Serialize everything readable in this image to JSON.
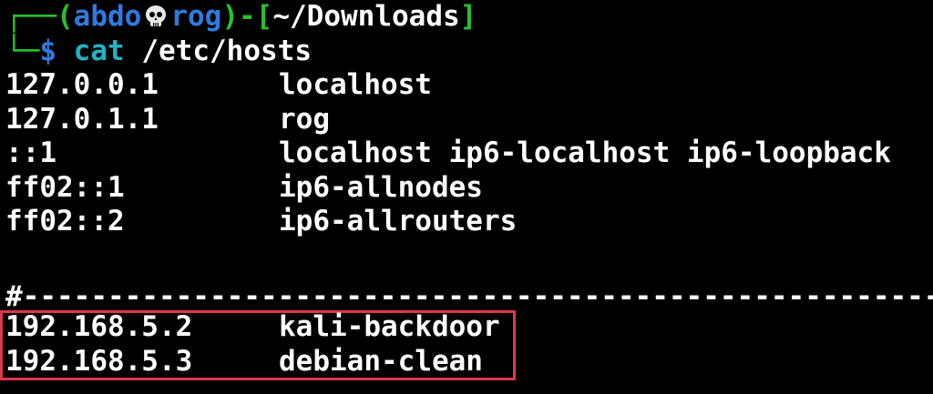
{
  "prompt": {
    "open_corner": "┌──",
    "lparen": "(",
    "user": "abdo",
    "skull_icon": "skull-icon",
    "host": "rog",
    "rparen": ")",
    "dash": "-",
    "lbracket": "[",
    "cwd": "~/Downloads",
    "rbracket": "]",
    "close_corner": "└─",
    "dollar": "$",
    "cmd_name": "cat",
    "cmd_arg": "/etc/hosts"
  },
  "hosts": [
    {
      "ip": "127.0.0.1",
      "names": "localhost"
    },
    {
      "ip": "127.0.1.1",
      "names": "rog"
    },
    {
      "ip": "::1",
      "names": "localhost ip6-localhost ip6-loopback"
    },
    {
      "ip": "ff02::1",
      "names": "ip6-allnodes"
    },
    {
      "ip": "ff02::2",
      "names": "ip6-allrouters"
    }
  ],
  "separator": "#-----------------------------------------------------------",
  "highlighted_hosts": [
    {
      "ip": "192.168.5.2",
      "names": "kali-backdoor"
    },
    {
      "ip": "192.168.5.3",
      "names": "debian-clean"
    }
  ],
  "colors": {
    "background": "#000000",
    "prompt_green": "#27c12b",
    "user_blue": "#2f7ae0",
    "command_cyan": "#1fb4c8",
    "text_white": "#ffffff",
    "highlight_red": "#e0364a"
  }
}
